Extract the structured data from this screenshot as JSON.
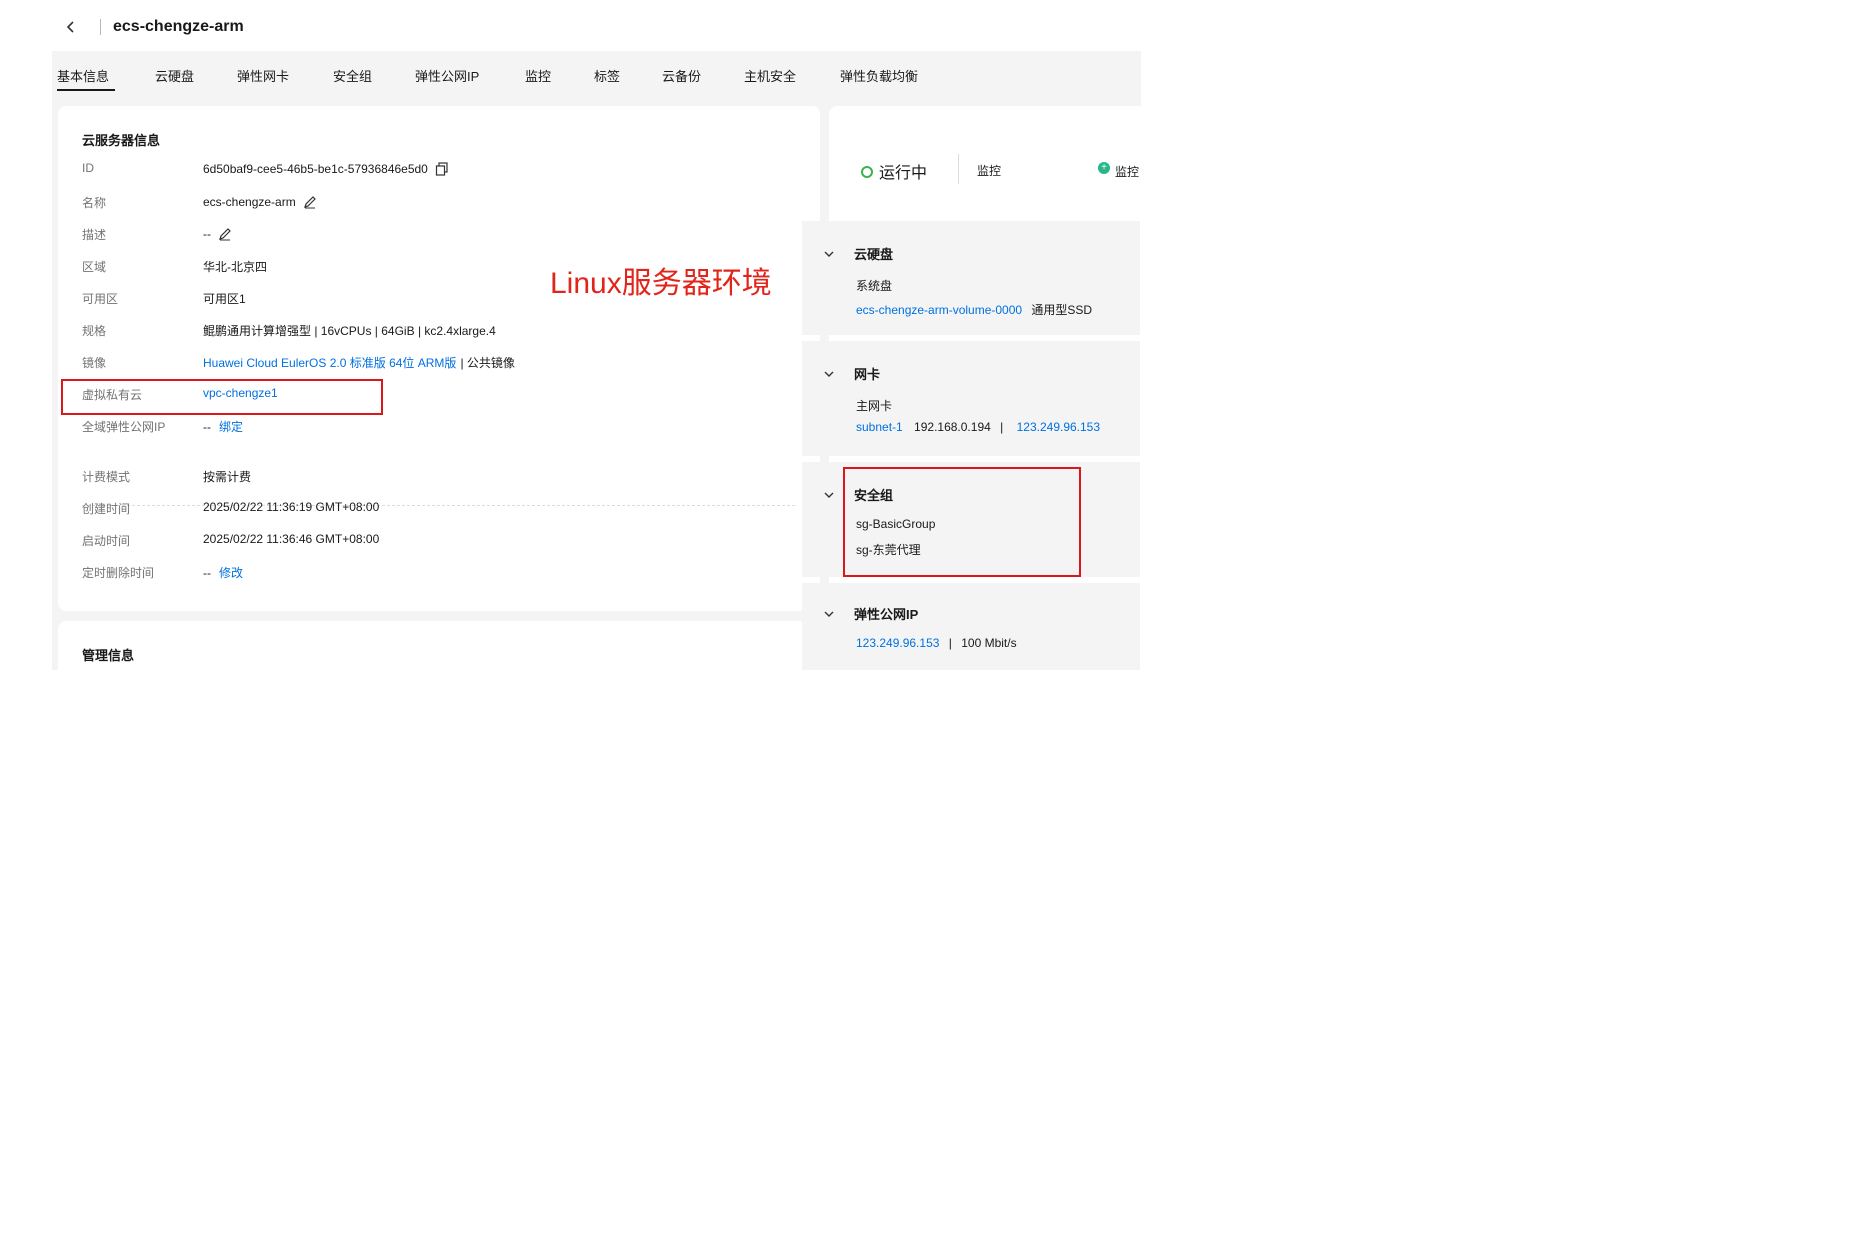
{
  "header": {
    "title": "ecs-chengze-arm"
  },
  "tabs": [
    {
      "label": "基本信息",
      "active": true
    },
    {
      "label": "云硬盘"
    },
    {
      "label": "弹性网卡"
    },
    {
      "label": "安全组"
    },
    {
      "label": "弹性公网IP"
    },
    {
      "label": "监控"
    },
    {
      "label": "标签"
    },
    {
      "label": "云备份"
    },
    {
      "label": "主机安全"
    },
    {
      "label": "弹性负载均衡"
    }
  ],
  "server_info": {
    "title": "云服务器信息",
    "id_label": "ID",
    "id_value": "6d50baf9-cee5-46b5-be1c-57936846e5d0",
    "name_label": "名称",
    "name_value": "ecs-chengze-arm",
    "desc_label": "描述",
    "desc_value": "--",
    "region_label": "区域",
    "region_value": "华北-北京四",
    "az_label": "可用区",
    "az_value": "可用区1",
    "flavor_label": "规格",
    "flavor_value": "鲲鹏通用计算增强型 | 16vCPUs | 64GiB | kc2.4xlarge.4",
    "image_label": "镜像",
    "image_link": "Huawei Cloud EulerOS 2.0 标准版 64位 ARM版",
    "image_suffix": "| 公共镜像",
    "vpc_label": "虚拟私有云",
    "vpc_value": "vpc-chengze1",
    "eip_label": "全域弹性公网IP",
    "eip_value": "--",
    "eip_action": "绑定",
    "billing_label": "计费模式",
    "billing_value": "按需计费",
    "created_label": "创建时间",
    "created_value": "2025/02/22 11:36:19 GMT+08:00",
    "started_label": "启动时间",
    "started_value": "2025/02/22 11:36:46 GMT+08:00",
    "delete_label": "定时删除时间",
    "delete_value": "--",
    "delete_action": "修改"
  },
  "annotation": {
    "text": "Linux服务器环境",
    "color": "#e1251b"
  },
  "management": {
    "title": "管理信息"
  },
  "status_panel": {
    "status": "运行中",
    "status_color": "#3bb34a",
    "monitor": "监控",
    "monitor2": "监控"
  },
  "disk_section": {
    "title": "云硬盘",
    "sys_label": "系统盘",
    "volume_link": "ecs-chengze-arm-volume-0000",
    "volume_type": "通用型SSD"
  },
  "nic_section": {
    "title": "网卡",
    "primary_label": "主网卡",
    "subnet_link": "subnet-1",
    "private_ip": "192.168.0.194",
    "sep": "|",
    "public_ip_link": "123.249.96.153"
  },
  "sg_section": {
    "title": "安全组",
    "groups": [
      "sg-BasicGroup",
      "sg-东莞代理"
    ]
  },
  "eip_section": {
    "title": "弹性公网IP",
    "ip_link": "123.249.96.153",
    "sep": "|",
    "bandwidth": "100 Mbit/s"
  },
  "colors": {
    "link": "#0070e0",
    "highlight_box": "#d9181e",
    "content_bg": "#f4f4f4"
  }
}
